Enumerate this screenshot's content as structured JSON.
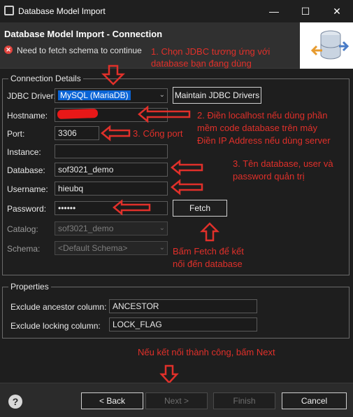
{
  "window": {
    "title": "Database Model Import"
  },
  "header": {
    "title": "Database Model Import - Connection",
    "error": "Need to fetch schema to continue"
  },
  "connection": {
    "group_label": "Connection Details",
    "driver_label": "JDBC Driver:",
    "driver_value": "MySQL (MariaDB)",
    "maintain_label": "Maintain JDBC Drivers",
    "hostname_label": "Hostname:",
    "hostname_value": "",
    "port_label": "Port:",
    "port_value": "3306",
    "instance_label": "Instance:",
    "instance_value": "",
    "database_label": "Database:",
    "database_value": "sof3021_demo",
    "username_label": "Username:",
    "username_value": "hieubq",
    "password_label": "Password:",
    "password_value": "••••••",
    "fetch_label": "Fetch",
    "catalog_label": "Catalog:",
    "catalog_value": "sof3021_demo",
    "schema_label": "Schema:",
    "schema_value": "<Default Schema>"
  },
  "properties": {
    "group_label": "Properties",
    "ancestor_label": "Exclude ancestor column:",
    "ancestor_value": "ANCESTOR",
    "locking_label": "Exclude locking column:",
    "locking_value": "LOCK_FLAG"
  },
  "annotations": {
    "a1_line1": "1. Chọn JDBC tương ứng với",
    "a1_line2": "database bạn đang dùng",
    "a2_line1": "2. Điền localhost nếu dùng phần",
    "a2_line2": "mềm code database trên máy",
    "a2_line3": "Điền IP Address nếu dùng server",
    "a3": "3. Cổng port",
    "a4_line1": "3. Tên database, user và",
    "a4_line2": "password quản trị",
    "a5_line1": "Bấm Fetch để kết",
    "a5_line2": "nối đến database",
    "a6": "Nếu kết nối thành công, bấm Next"
  },
  "footer": {
    "back": "< Back",
    "next": "Next >",
    "finish": "Finish",
    "cancel": "Cancel"
  },
  "colors": {
    "annotation": "#e0302a",
    "selection": "#0a64d6",
    "background": "#1e1e1e"
  }
}
